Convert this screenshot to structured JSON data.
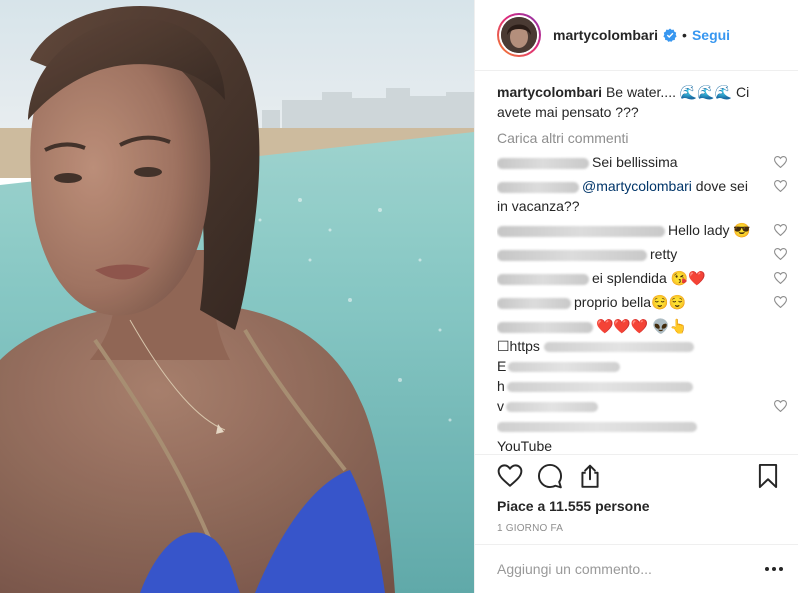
{
  "header": {
    "username": "martycolombari",
    "separator": "•",
    "follow_label": "Segui"
  },
  "caption": {
    "username": "martycolombari",
    "text": "Be water.... 🌊🌊🌊 Ci avete mai pensato ???"
  },
  "load_more_label": "Carica altri commenti",
  "comments": [
    {
      "text": "Sei bellissima"
    },
    {
      "mention": "@martycolombari",
      "text": " dove sei in vacanza??"
    },
    {
      "text": "Hello lady 😎"
    },
    {
      "text": "retty"
    },
    {
      "text": "ei splendida 😘❤️"
    },
    {
      "text": "proprio bella😌😌"
    },
    {
      "text": "❤️❤️❤️ 👽👆"
    },
    {
      "text": "☐https"
    },
    {
      "text": "E"
    },
    {
      "text": "h"
    },
    {
      "text": "v"
    },
    {
      "text": "YouTube"
    }
  ],
  "likes_text": "Piace a 11.555 persone",
  "time_text": "1 GIORNO FA",
  "add_comment_placeholder": "Aggiungi un commento...",
  "icons": {
    "like": "heart-icon",
    "comment": "comment-icon",
    "share": "share-icon",
    "save": "bookmark-icon",
    "verified": "verified-badge-icon",
    "more": "more-options-icon"
  },
  "colors": {
    "link_blue": "#3897f0",
    "text": "#262626",
    "muted": "#8e8e8e",
    "border": "#efefef",
    "sea": "#6fb8b4",
    "bikini": "#2f4fc8"
  }
}
